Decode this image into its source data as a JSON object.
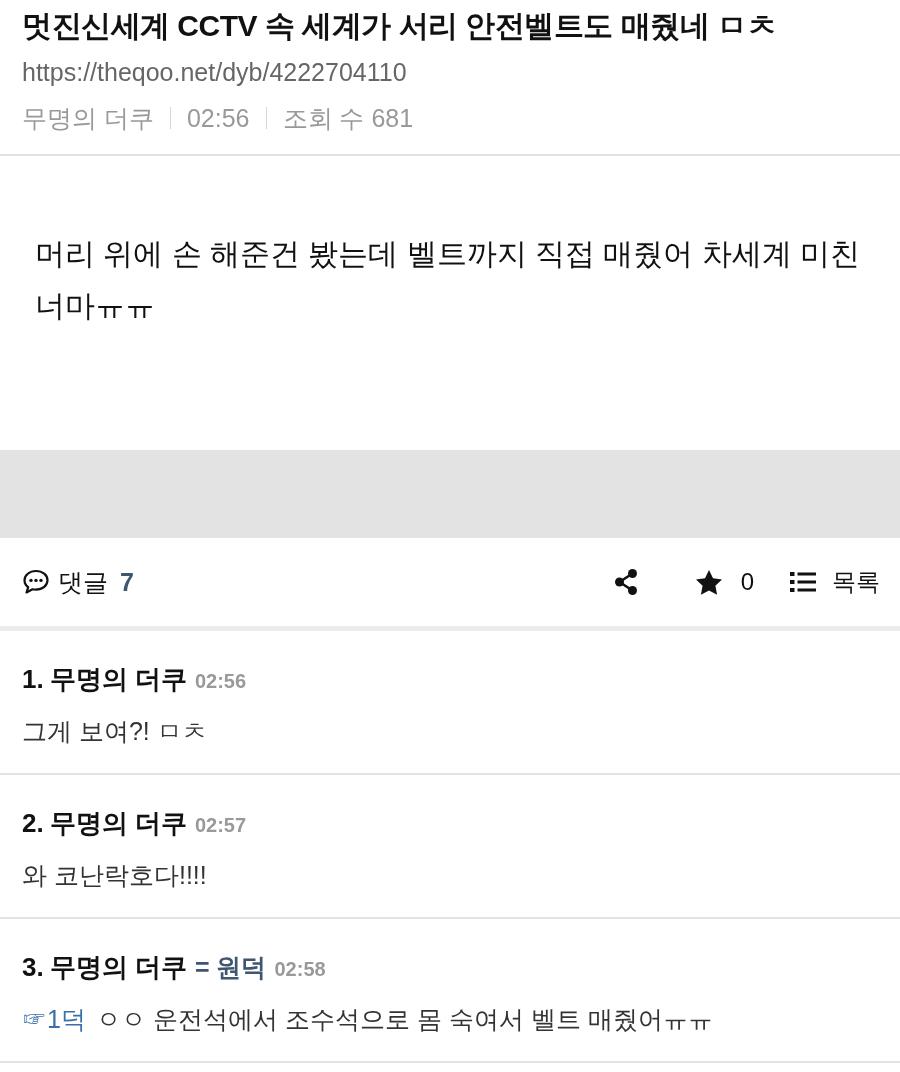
{
  "post": {
    "title": "멋진신세계 CCTV 속 세계가 서리 안전벨트도 매줬네 ㅁㅊ",
    "url": "https://theqoo.net/dyb/4222704110",
    "author": "무명의 더쿠",
    "time": "02:56",
    "views": "조회 수 681",
    "body": "머리 위에 손 해준건 봤는데 벨트까지 직접 매줬어 차세계 미친 너마ㅠㅠ"
  },
  "toolbar": {
    "comments_label": "댓글",
    "comments_count": "7",
    "star_count": "0",
    "list_label": "목록"
  },
  "comments": [
    {
      "number": "1.",
      "author": "무명의 더쿠",
      "time": "02:56",
      "text": "그게 보여?! ㅁㅊ"
    },
    {
      "number": "2.",
      "author": "무명의 더쿠",
      "time": "02:57",
      "text": "와 코난락호다!!!!"
    },
    {
      "number": "3.",
      "author": "무명의 더쿠",
      "author_tag": "= 원덕",
      "time": "02:58",
      "reply_to": "☞1덕",
      "text": "ㅇㅇ 운전석에서 조수석으로 몸 숙여서 벨트 매줬어ㅠㅠ"
    }
  ]
}
